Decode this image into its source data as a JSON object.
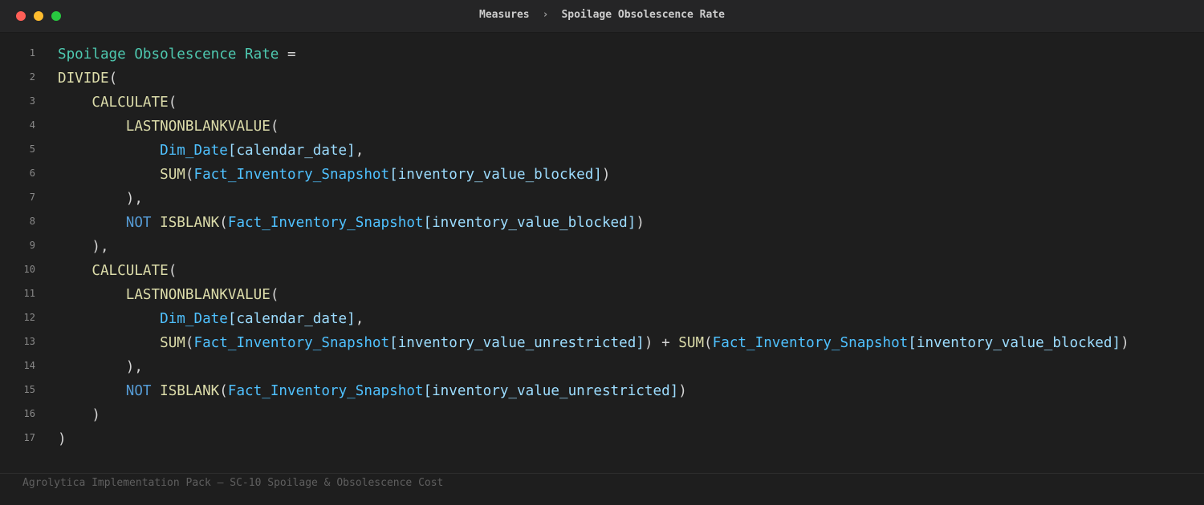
{
  "window": {
    "controls": [
      "close",
      "minimize",
      "maximize"
    ],
    "colors": {
      "close": "#ff5f57",
      "minimize": "#febc2e",
      "maximize": "#28c840"
    }
  },
  "breadcrumb": {
    "parent": "Measures",
    "separator": "›",
    "current": "Spoilage Obsolescence Rate"
  },
  "editor": {
    "theme_colors": {
      "name": "#4ec9b0",
      "function": "#dcdcaa",
      "keyword": "#569cd6",
      "table": "#4fc1ff",
      "column": "#9cdcfe",
      "punctuation": "#d4d4d4",
      "background": "#1e1e1e"
    },
    "lines": [
      {
        "number": "1",
        "indent": "",
        "tokens": [
          {
            "t": "name",
            "v": "Spoilage Obsolescence Rate"
          },
          {
            "t": "punc",
            "v": " ="
          }
        ]
      },
      {
        "number": "2",
        "indent": "",
        "tokens": [
          {
            "t": "fn",
            "v": "DIVIDE"
          },
          {
            "t": "punc",
            "v": "("
          }
        ]
      },
      {
        "number": "3",
        "indent": "    ",
        "tokens": [
          {
            "t": "fn",
            "v": "CALCULATE"
          },
          {
            "t": "punc",
            "v": "("
          }
        ]
      },
      {
        "number": "4",
        "indent": "        ",
        "tokens": [
          {
            "t": "fn",
            "v": "LASTNONBLANKVALUE"
          },
          {
            "t": "punc",
            "v": "("
          }
        ]
      },
      {
        "number": "5",
        "indent": "            ",
        "tokens": [
          {
            "t": "tbl",
            "v": "Dim_Date"
          },
          {
            "t": "col",
            "v": "[calendar_date]"
          },
          {
            "t": "punc",
            "v": ","
          }
        ]
      },
      {
        "number": "6",
        "indent": "            ",
        "tokens": [
          {
            "t": "fn",
            "v": "SUM"
          },
          {
            "t": "punc",
            "v": "("
          },
          {
            "t": "tbl",
            "v": "Fact_Inventory_Snapshot"
          },
          {
            "t": "col",
            "v": "[inventory_value_blocked]"
          },
          {
            "t": "punc",
            "v": ")"
          }
        ]
      },
      {
        "number": "7",
        "indent": "        ",
        "tokens": [
          {
            "t": "punc",
            "v": "),"
          }
        ]
      },
      {
        "number": "8",
        "indent": "        ",
        "tokens": [
          {
            "t": "kw",
            "v": "NOT"
          },
          {
            "t": "punc",
            "v": " "
          },
          {
            "t": "fn",
            "v": "ISBLANK"
          },
          {
            "t": "punc",
            "v": "("
          },
          {
            "t": "tbl",
            "v": "Fact_Inventory_Snapshot"
          },
          {
            "t": "col",
            "v": "[inventory_value_blocked]"
          },
          {
            "t": "punc",
            "v": ")"
          }
        ]
      },
      {
        "number": "9",
        "indent": "    ",
        "tokens": [
          {
            "t": "punc",
            "v": "),"
          }
        ]
      },
      {
        "number": "10",
        "indent": "    ",
        "tokens": [
          {
            "t": "fn",
            "v": "CALCULATE"
          },
          {
            "t": "punc",
            "v": "("
          }
        ]
      },
      {
        "number": "11",
        "indent": "        ",
        "tokens": [
          {
            "t": "fn",
            "v": "LASTNONBLANKVALUE"
          },
          {
            "t": "punc",
            "v": "("
          }
        ]
      },
      {
        "number": "12",
        "indent": "            ",
        "tokens": [
          {
            "t": "tbl",
            "v": "Dim_Date"
          },
          {
            "t": "col",
            "v": "[calendar_date]"
          },
          {
            "t": "punc",
            "v": ","
          }
        ]
      },
      {
        "number": "13",
        "indent": "            ",
        "tokens": [
          {
            "t": "fn",
            "v": "SUM"
          },
          {
            "t": "punc",
            "v": "("
          },
          {
            "t": "tbl",
            "v": "Fact_Inventory_Snapshot"
          },
          {
            "t": "col",
            "v": "[inventory_value_unrestricted]"
          },
          {
            "t": "punc",
            "v": ") + "
          },
          {
            "t": "fn",
            "v": "SUM"
          },
          {
            "t": "punc",
            "v": "("
          },
          {
            "t": "tbl",
            "v": "Fact_Inventory_Snapshot"
          },
          {
            "t": "col",
            "v": "[inventory_value_blocked]"
          },
          {
            "t": "punc",
            "v": ")"
          }
        ]
      },
      {
        "number": "14",
        "indent": "        ",
        "tokens": [
          {
            "t": "punc",
            "v": "),"
          }
        ]
      },
      {
        "number": "15",
        "indent": "        ",
        "tokens": [
          {
            "t": "kw",
            "v": "NOT"
          },
          {
            "t": "punc",
            "v": " "
          },
          {
            "t": "fn",
            "v": "ISBLANK"
          },
          {
            "t": "punc",
            "v": "("
          },
          {
            "t": "tbl",
            "v": "Fact_Inventory_Snapshot"
          },
          {
            "t": "col",
            "v": "[inventory_value_unrestricted]"
          },
          {
            "t": "punc",
            "v": ")"
          }
        ]
      },
      {
        "number": "16",
        "indent": "    ",
        "tokens": [
          {
            "t": "punc",
            "v": ")"
          }
        ]
      },
      {
        "number": "17",
        "indent": "",
        "tokens": [
          {
            "t": "punc",
            "v": ")"
          }
        ]
      }
    ]
  },
  "footer": {
    "text": "Agrolytica Implementation Pack — SC-10 Spoilage & Obsolescence Cost"
  }
}
